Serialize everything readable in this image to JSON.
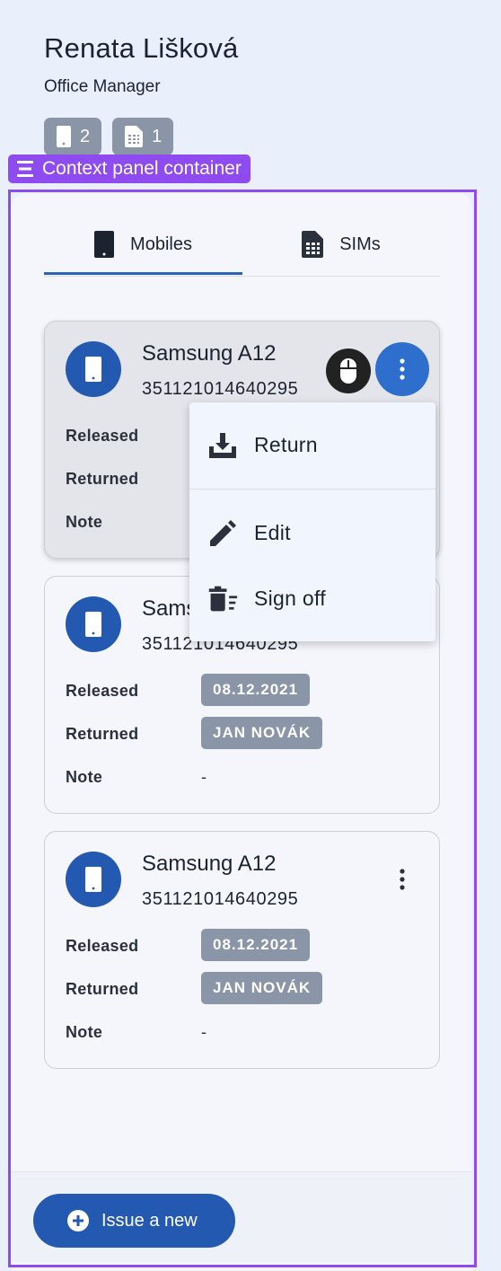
{
  "person": {
    "name": "Renata Lišková",
    "role": "Office Manager"
  },
  "counts": [
    {
      "icon": "mobile-icon",
      "value": "2"
    },
    {
      "icon": "sim-card-icon",
      "value": "1"
    }
  ],
  "context_label": "Context panel container",
  "tabs": [
    {
      "label": "Mobiles",
      "icon": "mobile-icon",
      "selected": true
    },
    {
      "label": "SIMs",
      "icon": "sim-card-icon",
      "selected": false
    }
  ],
  "labels": {
    "released": "Released",
    "returned": "Returned",
    "note": "Note"
  },
  "cards": [
    {
      "title": "Samsung A12",
      "imei": "351121014640295",
      "released": "",
      "returned": "",
      "note": "",
      "menu_open": true
    },
    {
      "title": "Samsung A12",
      "imei": "351121014640295",
      "released": "08.12.2021",
      "returned": "JAN NOVÁK",
      "note": "-"
    },
    {
      "title": "Samsung A12",
      "imei": "351121014640295",
      "released": "08.12.2021",
      "returned": "JAN NOVÁK",
      "note": "-"
    }
  ],
  "menu": {
    "items": [
      {
        "label": "Return",
        "icon": "download-tray-icon"
      },
      {
        "label": "Edit",
        "icon": "pencil-icon"
      },
      {
        "label": "Sign off",
        "icon": "delete-sweep-icon"
      }
    ]
  },
  "footer": {
    "issue_button": "Issue a new"
  },
  "colors": {
    "primary": "#2459b1",
    "accent_active": "#2e6fce",
    "badge": "#8a96a8",
    "highlight": "#8e4cf0",
    "background": "#e9effb"
  }
}
